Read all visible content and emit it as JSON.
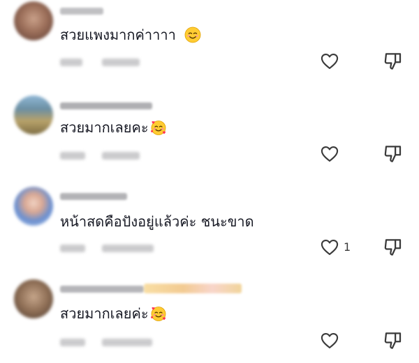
{
  "comments": [
    {
      "text": "สวยแพงมากค่าาาา",
      "emoji": "smiling-face-icon",
      "like_count": ""
    },
    {
      "text": "สวยมากเลยคะ",
      "emoji": "smiling-face-with-hearts-icon",
      "like_count": ""
    },
    {
      "text": "หน้าสดคือปังอยู่แล้วค่ะ ชนะขาด",
      "emoji": "",
      "like_count": "1"
    },
    {
      "text": "สวยมากเลยค่ะ",
      "emoji": "smiling-face-with-hearts-icon",
      "like_count": ""
    }
  ],
  "icons": {
    "like": "heart-outline-icon",
    "dislike": "thumbs-down-outline-icon"
  }
}
